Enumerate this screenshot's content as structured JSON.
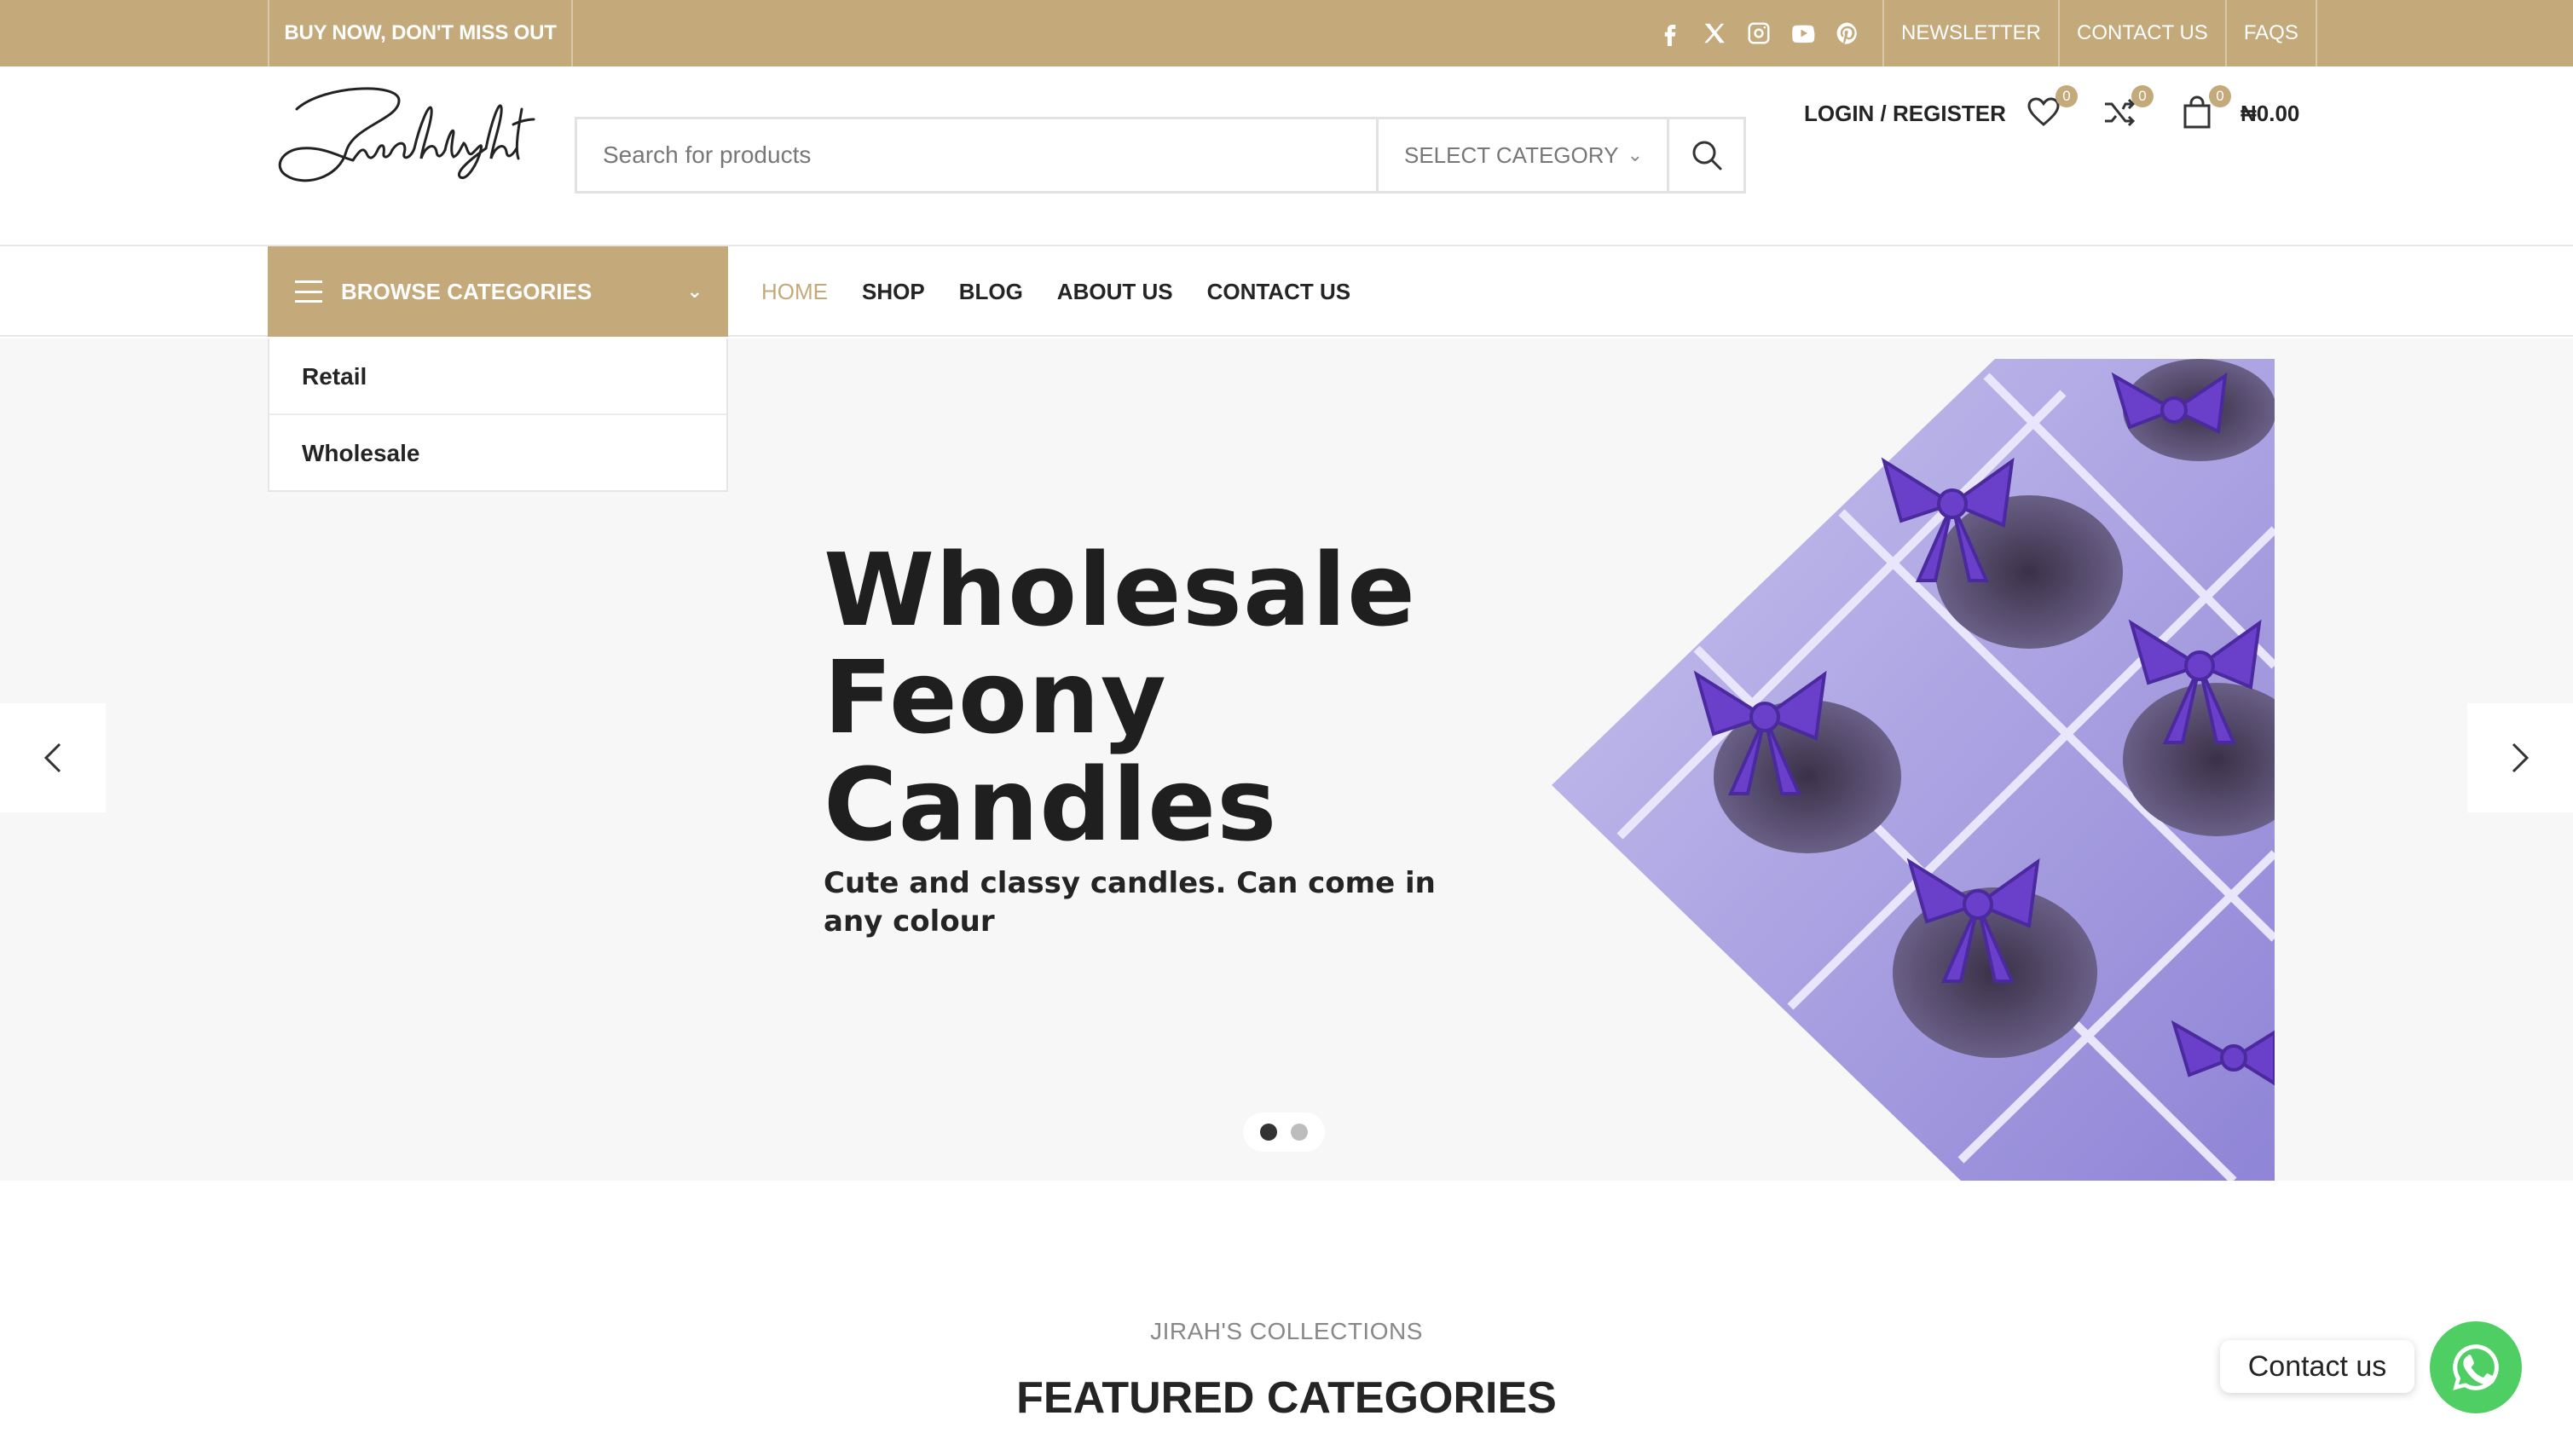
{
  "topbar": {
    "promo": "BUY NOW, DON'T MISS OUT",
    "social": [
      "facebook-icon",
      "x-icon",
      "instagram-icon",
      "youtube-icon",
      "pinterest-icon"
    ],
    "links": [
      "NEWSLETTER",
      "CONTACT US",
      "FAQS"
    ]
  },
  "header": {
    "logo_text": "Jirahslight",
    "search_placeholder": "Search for products",
    "category_select": "SELECT CATEGORY",
    "login": "LOGIN / REGISTER",
    "wishlist_count": "0",
    "compare_count": "0",
    "cart_count": "0",
    "cart_total": "₦0.00"
  },
  "nav": {
    "browse_label": "BROWSE CATEGORIES",
    "items": [
      "HOME",
      "SHOP",
      "BLOG",
      "ABOUT US",
      "CONTACT US"
    ],
    "active": "HOME"
  },
  "categories": [
    "Retail",
    "Wholesale"
  ],
  "hero": {
    "title_lines": [
      "Wholesale",
      "Feony",
      "Candles"
    ],
    "subtitle": "Cute and classy candles. Can come in any colour",
    "slide_count": 2,
    "active_slide": 1
  },
  "featured": {
    "eyebrow": "JIRAH'S COLLECTIONS",
    "title": "FEATURED CATEGORIES"
  },
  "whatsapp": {
    "label": "Contact us"
  },
  "colors": {
    "accent": "#c4a97a",
    "whatsapp": "#4fcf63",
    "hero_bg": "#f7f7f7"
  }
}
